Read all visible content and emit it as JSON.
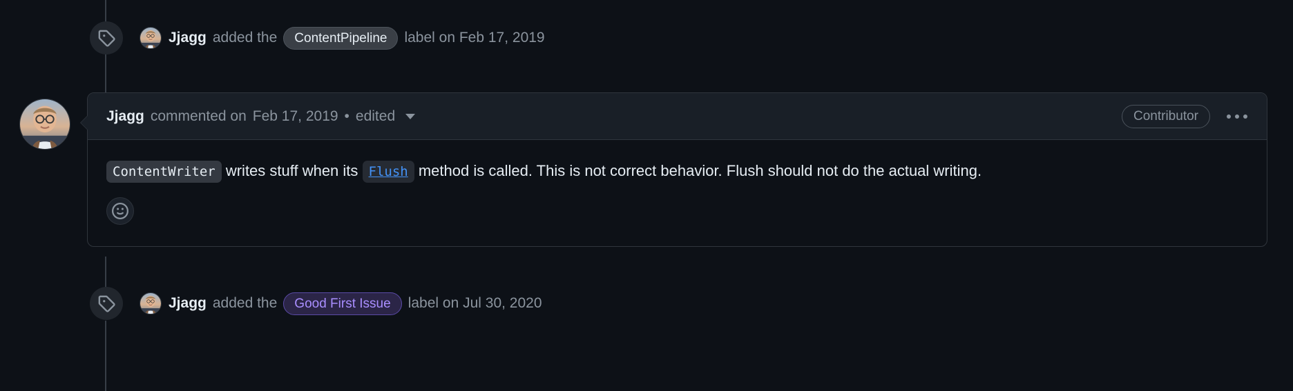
{
  "theme": {
    "page_background": "#0d1117",
    "comment_header_background": "#191f27",
    "border": "#30363d",
    "muted_text": "#8b949e",
    "primary_text": "#e6edf3",
    "link_blue": "#4493f8",
    "label_purple_text": "#a98eff",
    "label_purple_background": "#2b2547",
    "label_gray_background": "#3a3f46"
  },
  "timeline": {
    "events": [
      {
        "id": "label-added-contentpipeline",
        "icon": "tag-icon",
        "avatar": "avatar-jjagg",
        "actor": "Jjagg",
        "action": "added the",
        "label": "ContentPipeline",
        "label_style": "gray",
        "suffix": "label on Feb 17, 2019"
      },
      {
        "id": "label-added-goodfirstissue",
        "icon": "tag-icon",
        "avatar": "avatar-jjagg",
        "actor": "Jjagg",
        "action": "added the",
        "label": "Good First Issue",
        "label_style": "purple",
        "suffix": "label on Jul 30, 2020"
      }
    ]
  },
  "comment": {
    "avatar": "avatar-jjagg",
    "author": "Jjagg",
    "action": "commented on",
    "date": "Feb 17, 2019",
    "separator": "•",
    "edited_label": "edited",
    "edited_caret_icon": "chevron-down-icon",
    "association_badge": "Contributor",
    "menu_icon": "kebab-horizontal-icon",
    "body": {
      "code_1": "ContentWriter",
      "text_1": "writes stuff when its",
      "code_2": "Flush",
      "text_2": "method is called. This is not correct behavior. Flush should not do the actual writing."
    },
    "reaction_button_icon": "smiley-icon"
  }
}
